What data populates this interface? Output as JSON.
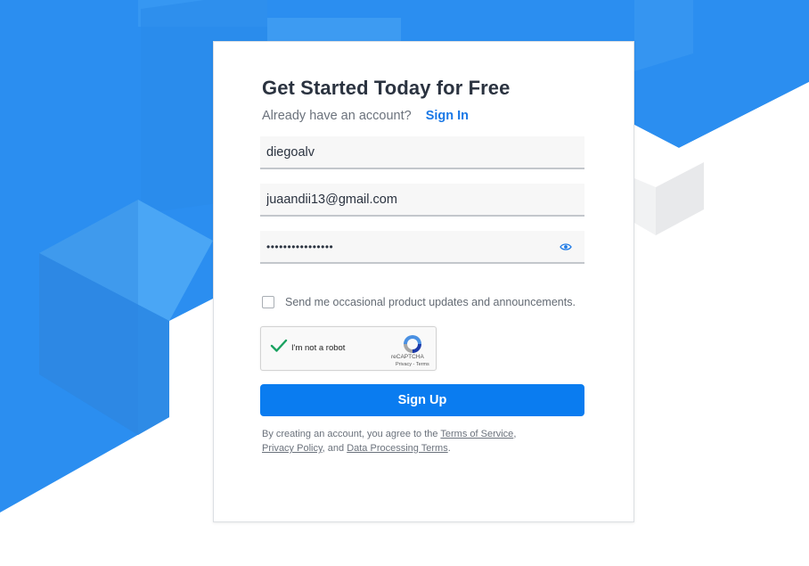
{
  "form": {
    "title": "Get Started Today for Free",
    "signin_prompt": "Already have an account?",
    "signin_link": "Sign In",
    "username_value": "diegoalv",
    "email_value": "juaandii13@gmail.com",
    "password_value": "••••••••••••••••",
    "consent_label": "Send me occasional product updates and announcements.",
    "signup_button": "Sign Up"
  },
  "recaptcha": {
    "label": "I'm not a robot",
    "brand": "reCAPTCHA",
    "terms": "Privacy - Terms"
  },
  "legal": {
    "prefix": "By creating an account, you agree to the",
    "terms_link": "Terms of Service",
    "comma": ",",
    "privacy_link": "Privacy Policy",
    "and_text": ", and",
    "dpt_link": "Data Processing Terms",
    "period": "."
  },
  "icons": {
    "eye": "eye-icon",
    "recaptcha_check": "check-icon",
    "recaptcha_logo": "recaptcha-logo-icon"
  },
  "colors": {
    "accent": "#0a7cf0",
    "link": "#1a78e6",
    "background_blue": "#2b8ef0",
    "title_text": "#2b3340"
  }
}
